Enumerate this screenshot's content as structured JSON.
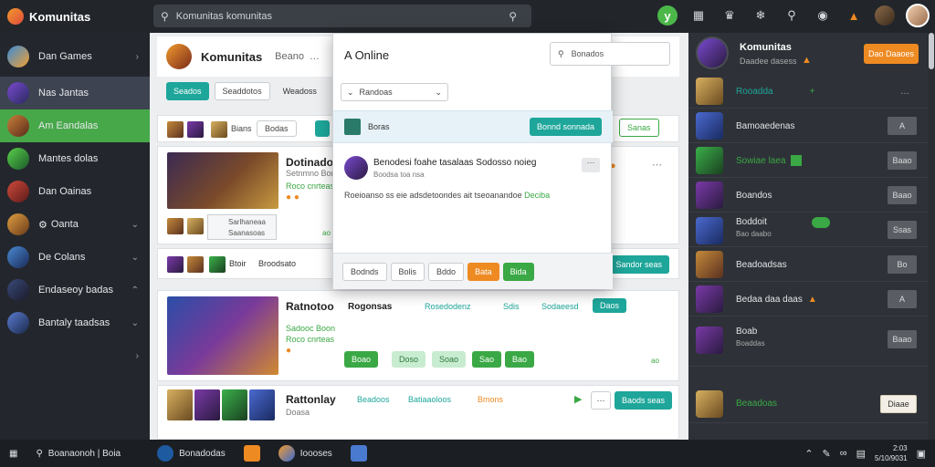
{
  "app": {
    "title": "Komunitas"
  },
  "search": {
    "placeholder": "Komunitas komunitas"
  },
  "top_icons": [
    "y-badge-icon",
    "bag-icon",
    "crown-icon",
    "fire-icon",
    "chat-icon",
    "bell-icon",
    "flame-icon",
    "avatar",
    "profile-avatar"
  ],
  "sidebar": {
    "items": [
      {
        "label": "Dan Games",
        "state": "normal"
      },
      {
        "label": "Nas Jantas",
        "state": "selected"
      },
      {
        "label": "Am Eandalas",
        "state": "green"
      },
      {
        "label": "Mantes dolas",
        "state": "normal"
      },
      {
        "label": "Dan Oainas",
        "state": "normal"
      },
      {
        "label": "Oanta",
        "state": "normal"
      },
      {
        "label": "De Colans",
        "state": "normal"
      },
      {
        "label": "Endaseoy badas",
        "state": "normal"
      },
      {
        "label": "Bantaly taadsas",
        "state": "normal"
      }
    ]
  },
  "main": {
    "header": {
      "title": "Komunitas",
      "badge": "Beano",
      "tag": "…"
    },
    "tabs": [
      "Seados",
      "Seaddotos",
      "Weadoss"
    ],
    "filter_row": {
      "btn1": "Bians",
      "btn2": "Bodas"
    },
    "card1": {
      "title": "Dotinado",
      "sub1": "Setnmno Borro",
      "sub2": "Roco cnrteas",
      "chip1": "Sarlhaneaa",
      "chip2": "Saanasoas",
      "link": "ao"
    },
    "strip": {
      "label1": "Btoir",
      "label2": "Broodsato",
      "btn": "Sandor seas"
    },
    "card2": {
      "title": "Ratnotoo",
      "user": "Rogonsas",
      "tag1": "Rosedodenz",
      "tag2": "Sdis",
      "tag3": "Sodaeesd",
      "btn": "Daos",
      "sub1": "Sadooc Boon",
      "sub2": "Roco cnrteas",
      "actions": [
        "Boao",
        "Doso",
        "Soao",
        "Sao",
        "Bao"
      ],
      "link": "ao"
    },
    "card3": {
      "title": "Rattonlay",
      "meta": "Doasa",
      "t1": "Beadoos",
      "t2": "Batiaaoloos",
      "t3": "Bmons",
      "btn": "Baods seas"
    }
  },
  "popup": {
    "title": "A Online",
    "select": "Randoas",
    "search_placeholder": "Bonados",
    "row_label": "Boras",
    "row_btn": "Bonnd sonnada",
    "row_btn2": "Sanas",
    "msg_name": "Benodesi foahe tasalaas Sodosso noieg",
    "msg_sub": "Boodsa toa nsa",
    "msg_text": "Roeioanso ss eie adsdetoondes ait tseoanandoe",
    "msg_link": "Deciba",
    "footer": [
      "Bodnds",
      "Bolis",
      "Bddo",
      "Bata",
      "Bida"
    ]
  },
  "rpanel": {
    "title": "Komunitas",
    "sub": "Daadee dasess",
    "top_btn": "Dao Daaoes",
    "items": [
      {
        "name": "Rooadda",
        "btn": "…"
      },
      {
        "name": "Bamoaedenas",
        "btn": "A"
      },
      {
        "name": "Sowiae laea",
        "btn": "Baao"
      },
      {
        "name": "Boandos",
        "btn": "Baao"
      },
      {
        "name": "Boddoit",
        "sub": "Bao daabo",
        "btn": "Ssas"
      },
      {
        "name": "Beadoadsas",
        "btn": "Bo"
      },
      {
        "name": "Bedaa daa daas",
        "btn": "A"
      },
      {
        "name": "Boab",
        "sub": "Boaddas",
        "btn": "Baao"
      },
      {
        "name": "Beaadoas",
        "btn": "Diaae"
      }
    ]
  },
  "taskbar": {
    "search": "Boanaonoh | Boia",
    "app1": "Bonadodas",
    "app2": "Ioooses",
    "time": "2:03",
    "date": "5/10/9031"
  },
  "colors": {
    "accent": "#1ea69a",
    "green": "#3aa844",
    "orange": "#ee8a22",
    "dark": "#23272d"
  }
}
